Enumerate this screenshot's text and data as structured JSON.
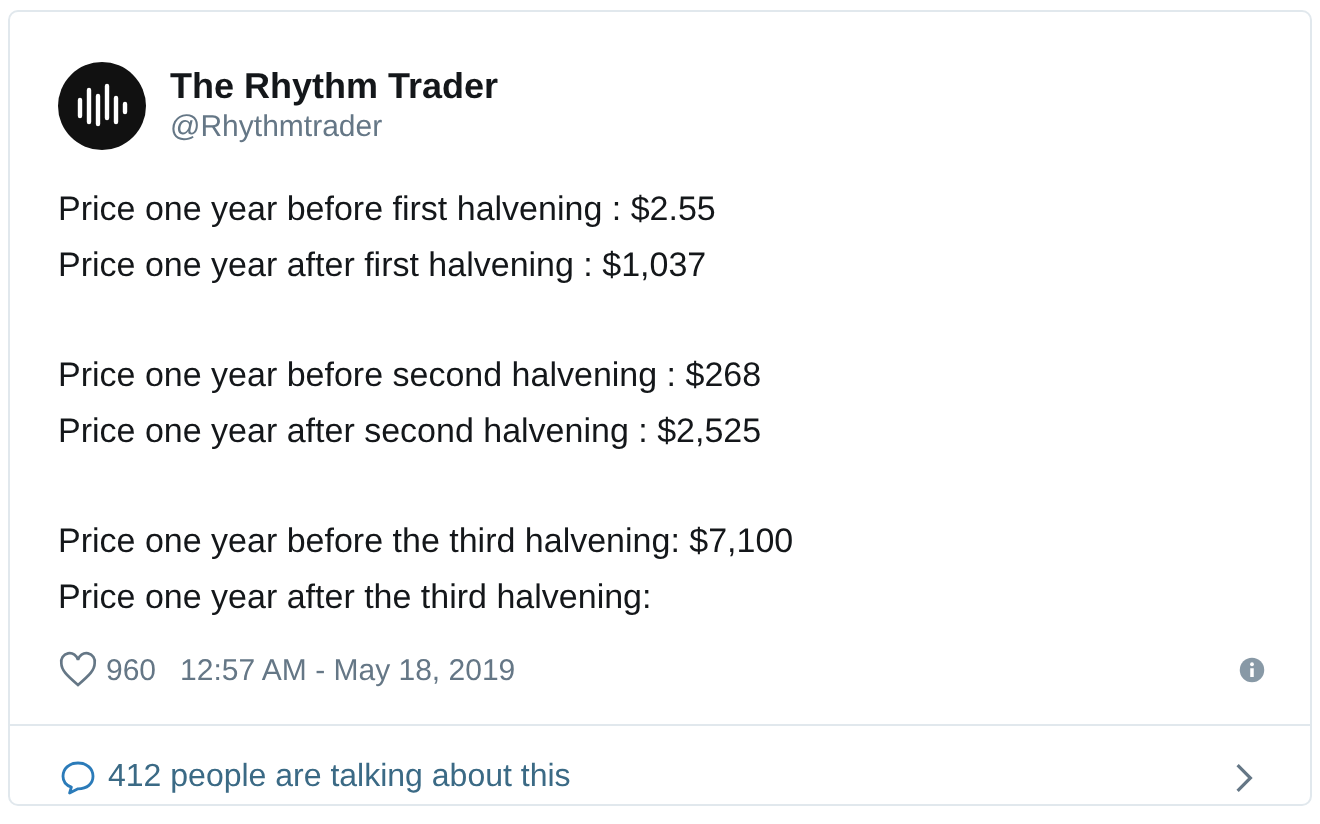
{
  "author": {
    "name": "The Rhythm Trader",
    "handle": "@Rhythmtrader"
  },
  "paragraphs": [
    [
      "Price one year before first halvening : $2.55",
      "Price one year after first halvening : $1,037"
    ],
    [
      "Price one year before second halvening : $268",
      "Price one year after second halvening : $2,525"
    ],
    [
      "Price one year before the third halvening: $7,100",
      "Price one year after the third halvening:"
    ]
  ],
  "likes": "960",
  "timestamp": "12:57 AM - May 18, 2019",
  "conversation": "412 people are talking about this"
}
